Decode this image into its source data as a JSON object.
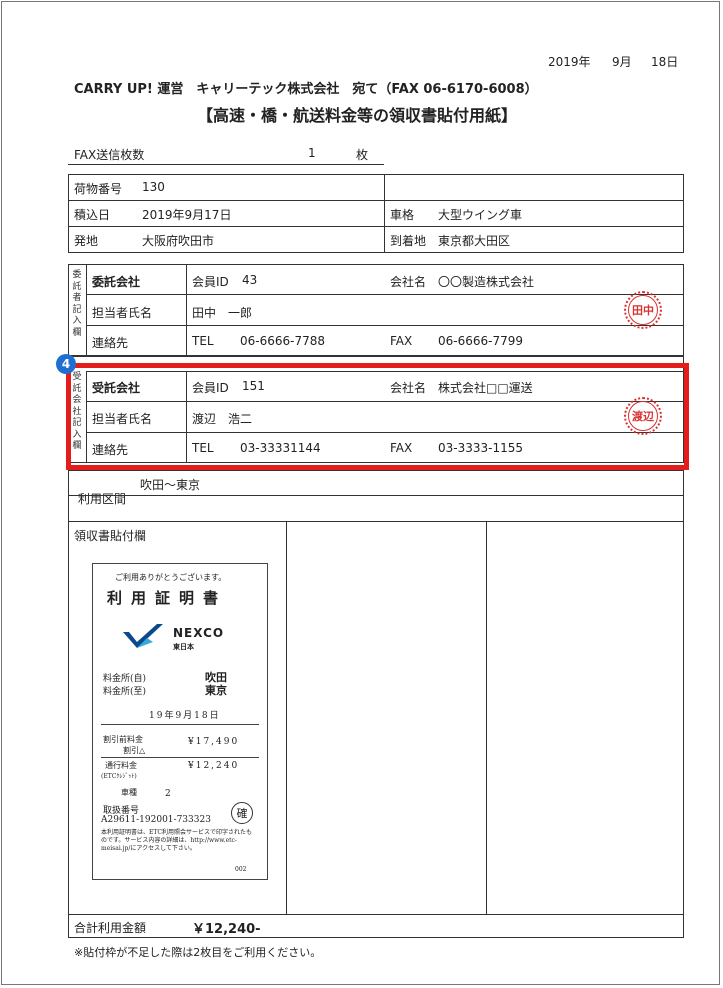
{
  "date": {
    "year": "2019年",
    "month": "9月",
    "day": "18日"
  },
  "addressee": "CARRY UP! 運営　キャリーテック株式会社　宛て（FAX 06-6170-6008）",
  "title": "【高速・橋・航送料金等の領収書貼付用紙】",
  "fax_count": {
    "label": "FAX送信枚数",
    "value": "1",
    "unit": "枚"
  },
  "cargo": {
    "number_label": "荷物番号",
    "number_value": "130",
    "date_label": "積込日",
    "date_value": "2019年9月17日",
    "vehicle_label": "車格",
    "vehicle_value": "大型ウイング車",
    "origin_label": "発地",
    "origin_value": "大阪府吹田市",
    "dest_label": "到着地",
    "dest_value": "東京都大田区"
  },
  "consignor": {
    "side_label": "委託者記入欄",
    "section_label": "委託会社",
    "member_id_label": "会員ID",
    "member_id_value": "43",
    "company_label": "会社名",
    "company_value": "〇〇製造株式会社",
    "person_label": "担当者氏名",
    "person_value": "田中　一郎",
    "stamp": "田中",
    "contact_label": "連絡先",
    "tel_label": "TEL",
    "tel_value": "06-6666-7788",
    "fax_label": "FAX",
    "fax_value": "06-6666-7799"
  },
  "consignee": {
    "badge": "4",
    "side_label": "受託会社記入欄",
    "section_label": "受託会社",
    "member_id_label": "会員ID",
    "member_id_value": "151",
    "company_label": "会社名",
    "company_value": "株式会社□□運送",
    "person_label": "担当者氏名",
    "person_value": "渡辺　浩二",
    "stamp": "渡辺",
    "contact_label": "連絡先",
    "tel_label": "TEL",
    "tel_value": "03-33331144",
    "fax_label": "FAX",
    "fax_value": "03-3333-1155"
  },
  "route": {
    "label": "利用区間",
    "value": "吹田～東京"
  },
  "receipt_area_label": "領収書貼付欄",
  "receipt": {
    "thanks": "ご利用ありがとうございます。",
    "heading": "利用証明書",
    "brand": "NEXCO",
    "brand_sub": "東日本",
    "from_label": "料金所(自)",
    "from_value": "吹田",
    "to_label": "料金所(至)",
    "to_value": "東京",
    "date": "19年9月18日",
    "pre_discount_label": "割引前料金",
    "discount_label": "割引△",
    "pre_discount_value": "¥17,490",
    "toll_label": "通行料金",
    "etc_label": "(ETCｸﾚｼﾞｯﾄ)",
    "toll_value": "¥12,240",
    "vehicle_type_label": "車種",
    "vehicle_type_value": "2",
    "handling_label": "取扱番号",
    "handling_value": "A29611-192001-733323",
    "seal": "確",
    "note": "本利用証明書は、ETC利用照会サービスで印字されたものです。サービス内容の詳細は、http://www.etc-meisai.jp/にアクセスして下さい。",
    "code": "002"
  },
  "total": {
    "label": "合計利用金額",
    "value": "￥12,240-"
  },
  "footnote": "※貼付枠が不足した際は2枚目をご利用ください。"
}
